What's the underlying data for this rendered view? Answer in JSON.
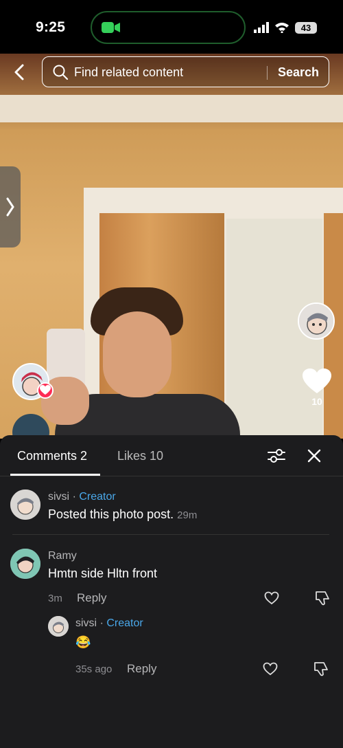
{
  "status_bar": {
    "time": "9:25",
    "battery": "43"
  },
  "search": {
    "placeholder": "Find related content",
    "button_label": "Search"
  },
  "post": {
    "like_count": "10"
  },
  "tabs": {
    "comments_label": "Comments 2",
    "likes_label": "Likes 10"
  },
  "comments": [
    {
      "name": "sivsi",
      "separator": "·",
      "badge": "Creator",
      "text": "Posted this photo post.",
      "time": "29m"
    },
    {
      "name": "Ramy",
      "text": "Hmtn side Hltn front",
      "time": "3m",
      "reply_label": "Reply",
      "replies": [
        {
          "name": "sivsi",
          "separator": "·",
          "badge": "Creator",
          "text": "😂",
          "time": "35s ago",
          "reply_label": "Reply"
        }
      ]
    }
  ],
  "colors": {
    "creator_badge": "#4aa8ea",
    "like_badge": "#fe2c55",
    "panel_bg": "#1c1c1e"
  }
}
